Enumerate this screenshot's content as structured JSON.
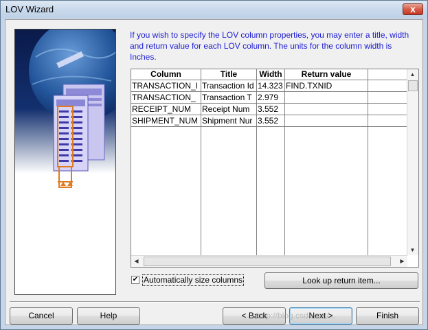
{
  "window": {
    "title": "LOV Wizard",
    "close_glyph": "x"
  },
  "instructions": "If you wish to specify the LOV column properties, you may enter a title, width and return value for each LOV column. The units for the column width is Inches.",
  "table": {
    "headers": [
      "Column",
      "Title",
      "Width",
      "Return value",
      ""
    ],
    "rows": [
      [
        "TRANSACTION_I",
        "Transaction Id",
        "14.323",
        "FIND.TXNID"
      ],
      [
        "TRANSACTION_",
        "Transaction T",
        "2.979",
        ""
      ],
      [
        "RECEIPT_NUM",
        "Receipt Num",
        "3.552",
        ""
      ],
      [
        "SHIPMENT_NUM",
        "Shipment Nur",
        "3.552",
        ""
      ]
    ]
  },
  "auto_size": {
    "label": "Automatically size columns",
    "checked": true,
    "check_glyph": "✔"
  },
  "lookup_button": "Look up return item...",
  "footer": {
    "cancel": "Cancel",
    "help": "Help",
    "back": "< Back",
    "next": "Next >",
    "finish": "Finish"
  },
  "watermark": "http://blog.csdn.net/...",
  "icons": [
    "close-icon",
    "scroll-up-icon",
    "scroll-down-icon",
    "scroll-left-icon",
    "scroll-right-icon",
    "wizard-illustration-icon"
  ]
}
